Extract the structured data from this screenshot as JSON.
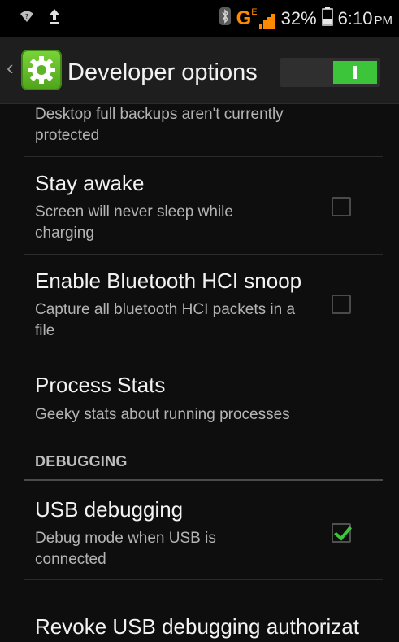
{
  "status_bar": {
    "left_icons": [
      "wifi-question-icon",
      "upload-arrow-icon"
    ],
    "right_icons": [
      "bluetooth-icon",
      "signal-edge-icon",
      "battery-icon"
    ],
    "network_type": "G",
    "network_superscript": "E",
    "battery_percent": "32%",
    "time": "6:10",
    "ampm": "PM"
  },
  "action_bar": {
    "back_caret": "‹",
    "icon": "settings-gear-icon",
    "title": "Developer options",
    "master_toggle_on": true
  },
  "list": {
    "partial_item": {
      "summary": "Desktop full backups aren't currently protected"
    },
    "items": [
      {
        "title": "Stay awake",
        "summary": "Screen will never sleep while charging",
        "checked": false
      },
      {
        "title": "Enable Bluetooth HCI snoop log",
        "summary": "Capture all bluetooth HCI packets in a file",
        "checked": false
      },
      {
        "title": "Process Stats",
        "summary": "Geeky stats about running processes"
      }
    ],
    "section_header": "DEBUGGING",
    "debug_items": [
      {
        "title": "USB debugging",
        "summary": "Debug mode when USB is connected",
        "checked": true
      },
      {
        "title": "Revoke USB debugging authorizations"
      }
    ]
  },
  "colors": {
    "accent_green": "#3cc43a",
    "background": "#0e0e0e",
    "actionbar": "#1e1e1e"
  }
}
